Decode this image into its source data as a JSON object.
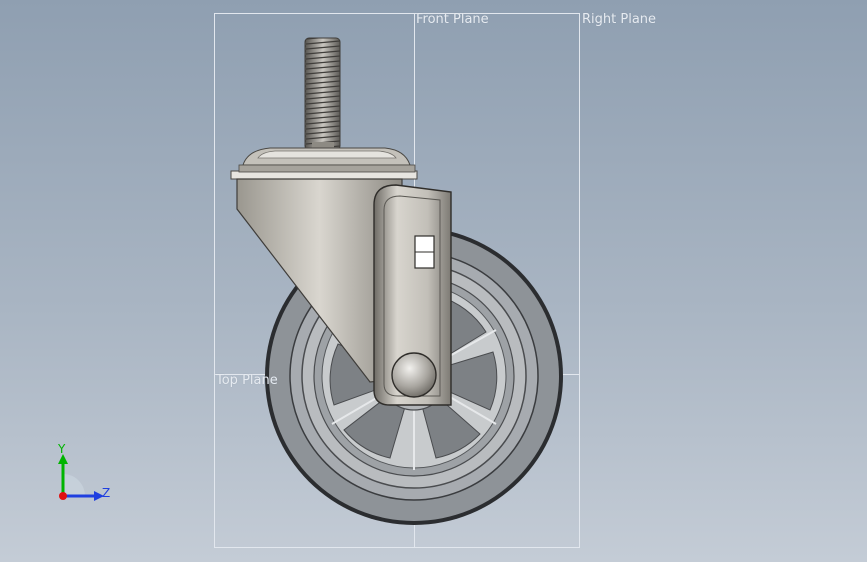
{
  "viewport": {
    "planes": {
      "front": "Front Plane",
      "right": "Right Plane",
      "top": "Top Plane"
    },
    "triad": {
      "y_label": "Y",
      "z_label": "Z",
      "y_color": "#00b400",
      "z_color": "#1f3fe0",
      "x_color": "#e01010"
    },
    "model": {
      "part": "swivel-caster",
      "tire_color": "#8e9398",
      "hub_color": "#b9bcbf",
      "metal_color": "#a8a49b"
    },
    "colors": {
      "background_top": "#8f9fb1",
      "background_bottom": "#c4ccd6",
      "plane_outline": "#e2e7ee"
    }
  }
}
